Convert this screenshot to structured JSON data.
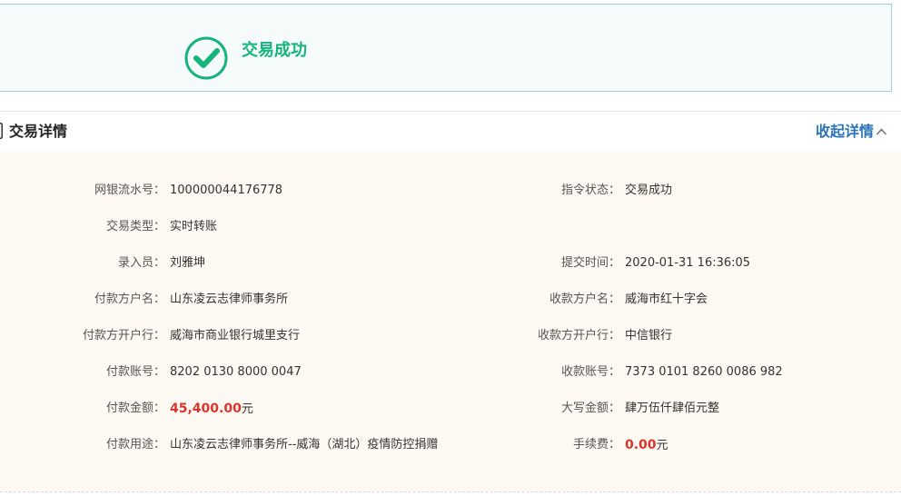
{
  "banner": {
    "status_text": "交易成功",
    "icon": "check-circle-icon",
    "accent_color": "#16b47b"
  },
  "details": {
    "title": "交易详情",
    "collapse_label": "收起详情",
    "collapse_icon": "chevron-up-icon",
    "fields": {
      "serial_no": {
        "label": "网银流水号：",
        "value": "100000044176778"
      },
      "instruction_status": {
        "label": "指令状态：",
        "value": "交易成功"
      },
      "tx_type": {
        "label": "交易类型：",
        "value": "实时转账"
      },
      "entered_by": {
        "label": "录入员：",
        "value": "刘雅坤"
      },
      "submit_time": {
        "label": "提交时间：",
        "value": "2020-01-31 16:36:05"
      },
      "payer_name": {
        "label": "付款方户名：",
        "value": "山东凌云志律师事务所"
      },
      "payee_name": {
        "label": "收款方户名：",
        "value": "威海市红十字会"
      },
      "payer_bank": {
        "label": "付款方开户行：",
        "value": "威海市商业银行城里支行"
      },
      "payee_bank": {
        "label": "收款方开户行：",
        "value": "中信银行"
      },
      "payer_account": {
        "label": "付款账号：",
        "value": "8202 0130 8000 0047"
      },
      "payee_account": {
        "label": "收款账号：",
        "value": "7373 0101 8260 0086 982"
      },
      "amount": {
        "label": "付款金额：",
        "value": "45,400.00",
        "unit": "元"
      },
      "amount_in_words": {
        "label": "大写金额：",
        "value": "肆万伍仟肆佰元整"
      },
      "purpose": {
        "label": "付款用途：",
        "value": "山东凌云志律师事务所--威海（湖北）疫情防控捐赠"
      },
      "fee": {
        "label": "手续费：",
        "value": "0.00",
        "unit": "元"
      }
    }
  },
  "colors": {
    "amount_red": "#d9352b",
    "link_blue": "#2c74b8",
    "banner_border": "#9fd3d1",
    "details_bg": "#fff8f3"
  }
}
